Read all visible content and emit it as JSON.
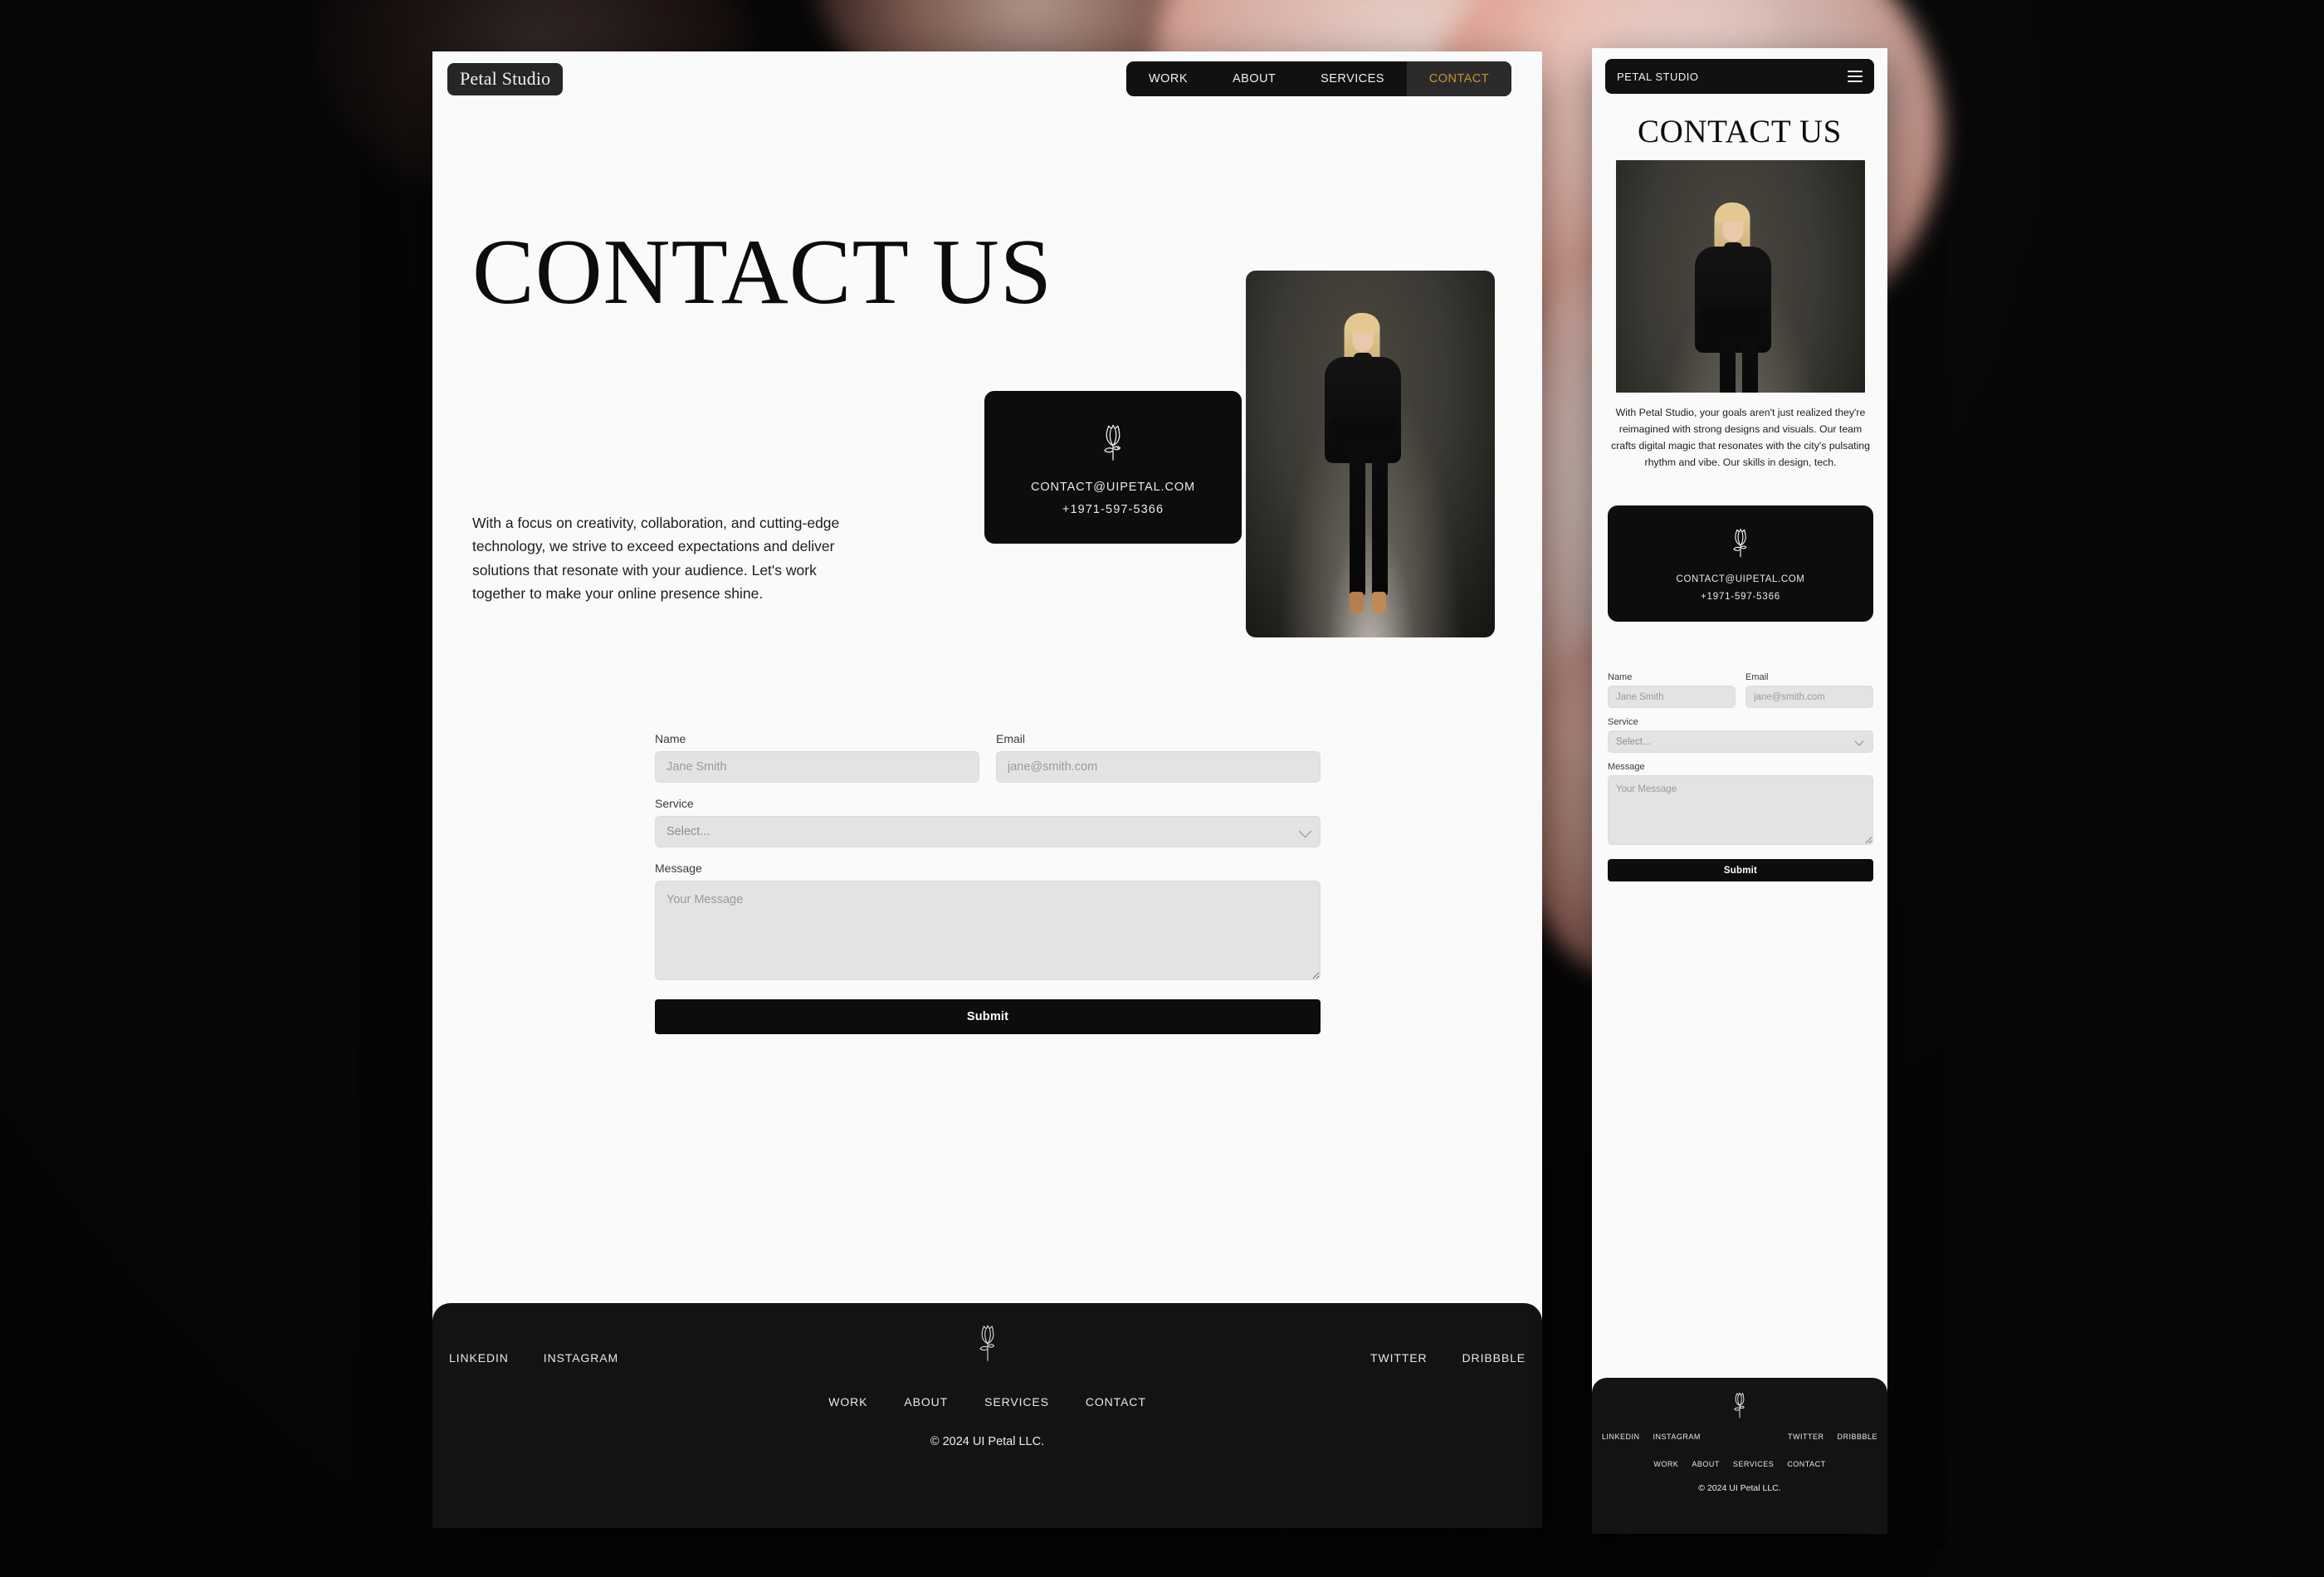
{
  "brand": {
    "logo": "Petal Studio",
    "mobile_logo": "PETAL STUDIO"
  },
  "colors": {
    "accent": "#c8922f",
    "dark": "#0d0d0d",
    "surface": "#fafafa",
    "field": "#e3e3e3"
  },
  "desktop": {
    "nav": [
      {
        "label": "WORK",
        "active": false
      },
      {
        "label": "ABOUT",
        "active": false
      },
      {
        "label": "SERVICES",
        "active": false
      },
      {
        "label": "CONTACT",
        "active": true
      }
    ],
    "hero": {
      "title": "CONTACT US",
      "copy": "With a focus on creativity, collaboration, and cutting-edge technology, we strive to exceed expectations and deliver solutions that resonate with your audience. Let's work together to make your online presence shine."
    },
    "contact_card": {
      "icon": "rose-icon",
      "email": "CONTACT@UIPETAL.COM",
      "phone": "+1971-597-5366"
    },
    "portrait_alt": "woman in black suit standing",
    "form": {
      "name_label": "Name",
      "name_placeholder": "Jane Smith",
      "email_label": "Email",
      "email_placeholder": "jane@smith.com",
      "service_label": "Service",
      "service_value": "Select...",
      "service_options": [
        "Select..."
      ],
      "message_label": "Message",
      "message_placeholder": "Your Message",
      "submit_label": "Submit"
    },
    "footer": {
      "social_left": [
        "LINKEDIN",
        "INSTAGRAM"
      ],
      "social_right": [
        "TWITTER",
        "DRIBBBLE"
      ],
      "nav": [
        "WORK",
        "ABOUT",
        "SERVICES",
        "CONTACT"
      ],
      "copyright": "© 2024 UI Petal LLC."
    }
  },
  "mobile": {
    "menu_icon": "hamburger-icon",
    "hero": {
      "title": "CONTACT US",
      "copy": "With Petal Studio, your goals aren't just realized they're reimagined with strong designs and visuals. Our team crafts digital magic that resonates with the city's pulsating rhythm and vibe. Our skills in design, tech."
    },
    "contact_card": {
      "icon": "rose-icon",
      "email": "CONTACT@UIPETAL.COM",
      "phone": "+1971-597-5366"
    },
    "form": {
      "name_label": "Name",
      "name_placeholder": "Jane Smith",
      "email_label": "Email",
      "email_placeholder": "jane@smith.com",
      "service_label": "Service",
      "service_value": "Select...",
      "message_label": "Message",
      "message_placeholder": "Your Message",
      "submit_label": "Submit"
    },
    "footer": {
      "social_left": [
        "LINKEDIN",
        "INSTAGRAM"
      ],
      "social_right": [
        "TWITTER",
        "DRIBBBLE"
      ],
      "nav": [
        "WORK",
        "ABOUT",
        "SERVICES",
        "CONTACT"
      ],
      "copyright": "© 2024 UI Petal LLC."
    }
  }
}
